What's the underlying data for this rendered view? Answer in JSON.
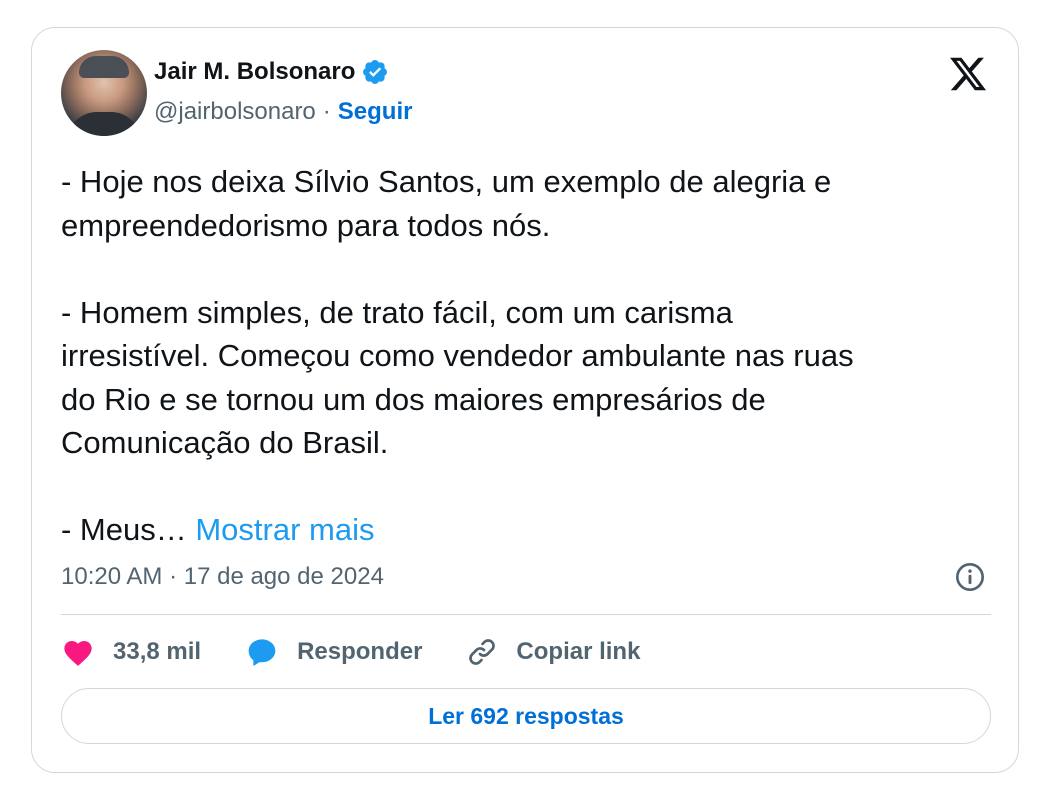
{
  "author": {
    "name": "Jair M. Bolsonaro",
    "handle": "@jairbolsonaro",
    "separator": "·",
    "follow_label": "Seguir",
    "avatar_icon": "user-avatar",
    "verified_icon": "verified-badge-icon",
    "verified_color": "#1d9bf0"
  },
  "brand": {
    "logo_icon": "x-logo-icon"
  },
  "tweet": {
    "text": "- Hoje nos deixa Sílvio Santos, um exemplo de alegria e\nempreendedorismo para todos nós.\n\n- Homem simples, de trato fácil, com um carisma\nirresistível. Começou como vendedor ambulante nas ruas\ndo Rio e se tornou um dos maiores empresários de\nComunicação do Brasil.\n\n- Meus… ",
    "show_more": "Mostrar mais",
    "timestamp": "10:20 AM · 17 de ago de 2024",
    "info_icon": "info-icon"
  },
  "actions": {
    "likes": {
      "icon": "heart-icon",
      "label": "33,8 mil",
      "color": "#f91880"
    },
    "reply": {
      "icon": "reply-bubble-icon",
      "label": "Responder",
      "color": "#1d9bf0"
    },
    "copy": {
      "icon": "link-icon",
      "label": "Copiar link"
    }
  },
  "replies_button": "Ler 692 respostas",
  "colors": {
    "link": "#1d9bf0",
    "follow": "#006fd6",
    "muted": "#536471",
    "border": "#cfd9de"
  }
}
